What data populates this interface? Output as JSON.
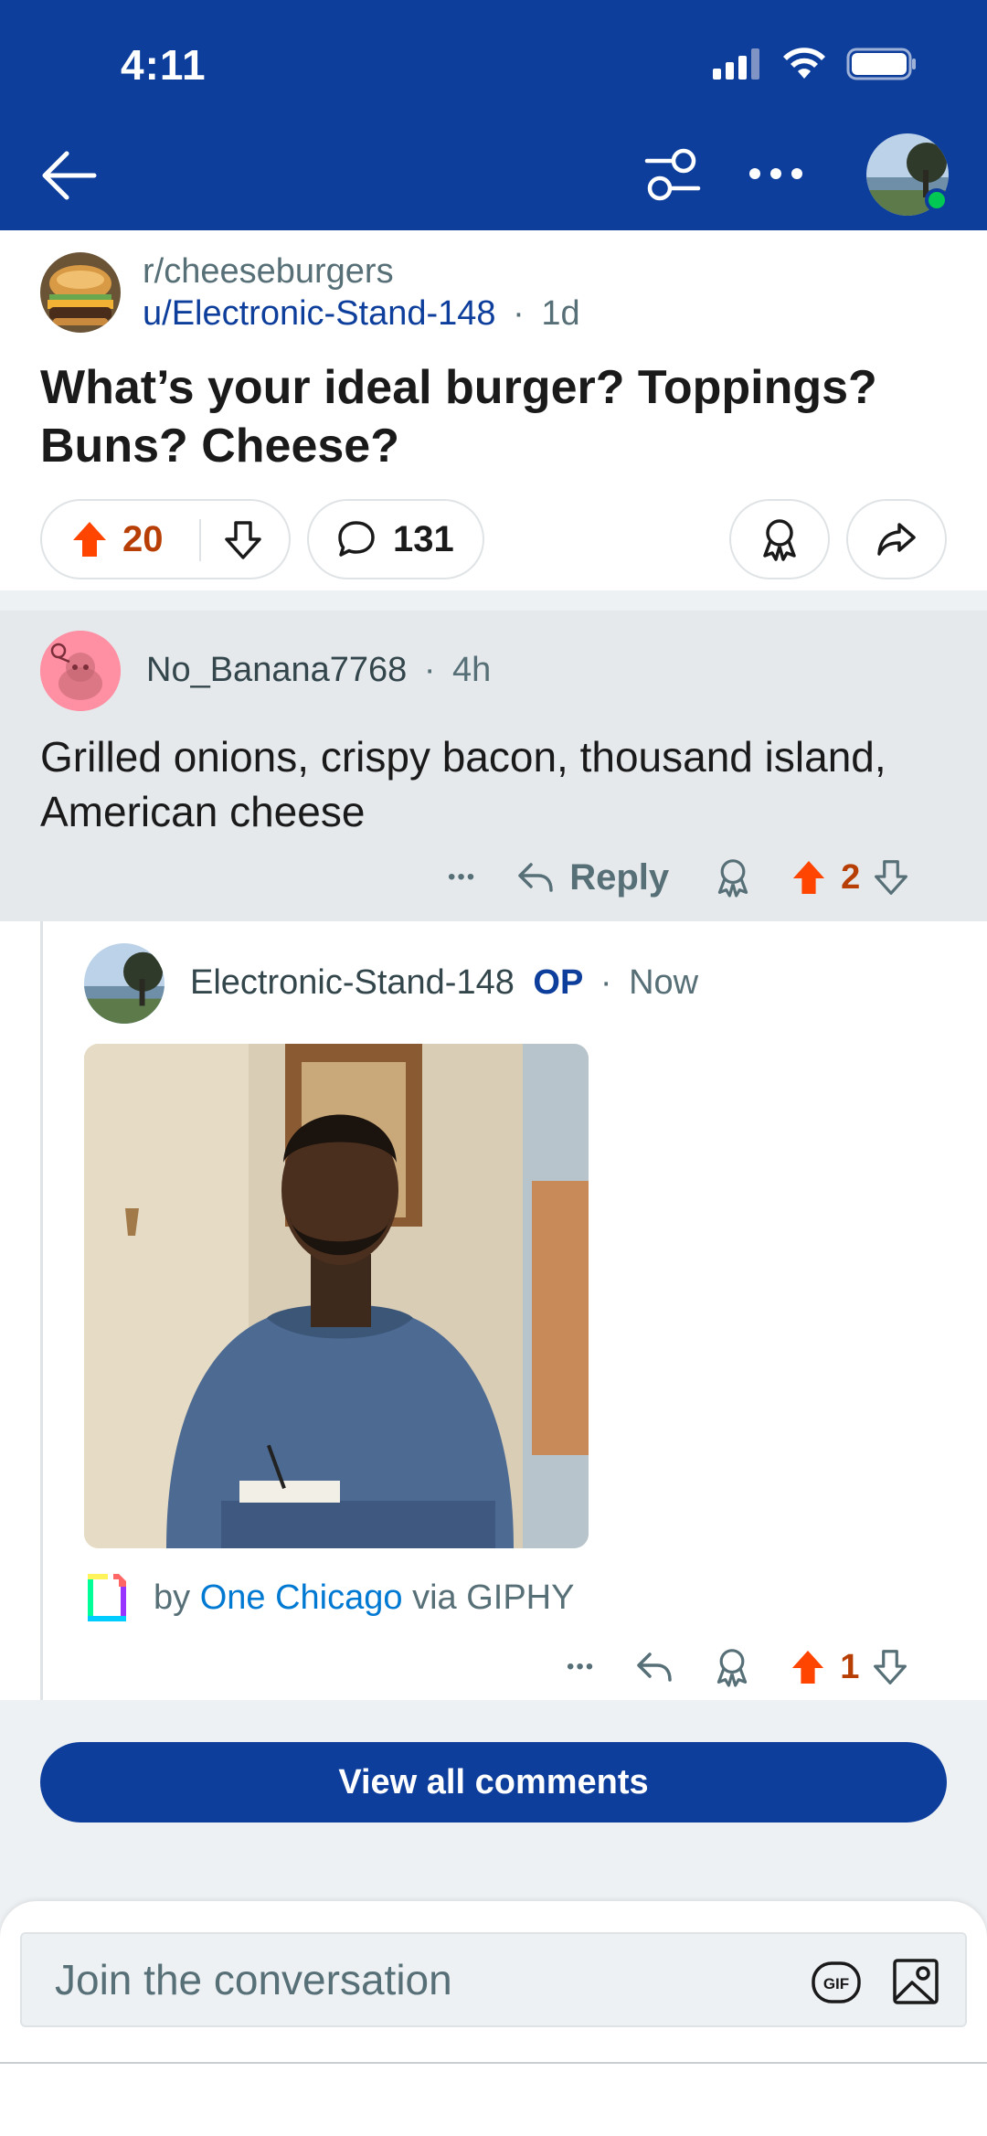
{
  "status_bar": {
    "time": "4:11"
  },
  "post": {
    "subreddit": "r/cheeseburgers",
    "author": "u/Electronic-Stand-148",
    "separator": "·",
    "age": "1d",
    "title": "What’s your ideal burger? Toppings? Buns? Cheese?",
    "score": "20",
    "comment_count": "131"
  },
  "comments": [
    {
      "author": "No_Banana7768",
      "separator": "·",
      "age": "4h",
      "body": "Grilled onions, crispy bacon, thousand island, American cheese",
      "more": "•••",
      "reply_label": "Reply",
      "score": "2"
    },
    {
      "author": "Electronic-Stand-148",
      "op_badge": "OP",
      "separator": "·",
      "age": "Now",
      "giphy_by": "by",
      "giphy_source": "One Chicago",
      "giphy_via": "via GIPHY",
      "more": "•••",
      "score": "1"
    }
  ],
  "view_all_label": "View all comments",
  "composer": {
    "placeholder": "Join the conversation",
    "gif_label": "GIF"
  },
  "colors": {
    "header_bg": "#0d3e9c",
    "upvote": "#ff4500",
    "score_text": "#b73e05",
    "highlight_bg": "#e5e9ec",
    "link": "#0079d3"
  }
}
